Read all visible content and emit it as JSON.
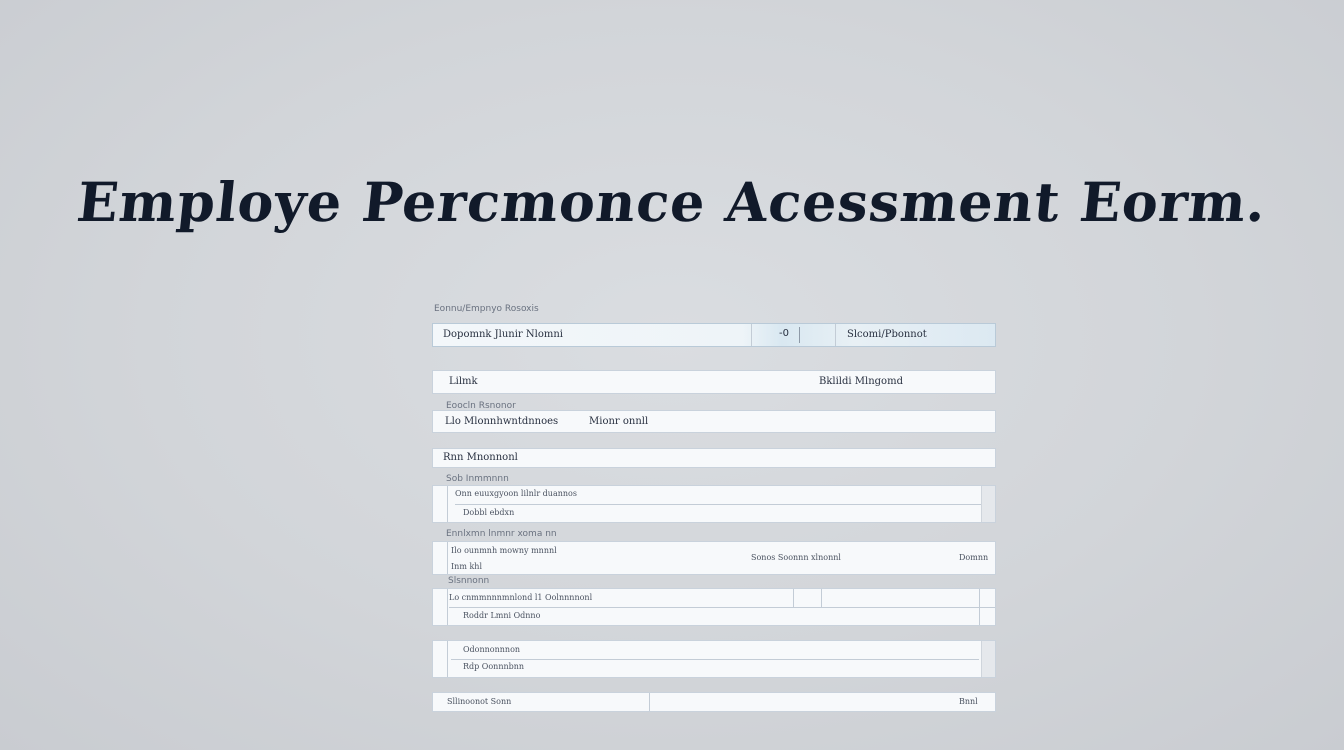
{
  "page_title": "Employe Percmonce Acessment Eorm.",
  "form": {
    "section_label": "Eonnu/Empnyo Rosoxis",
    "row1": {
      "field_value": "Dopomnk Jlunir Nlomni",
      "icon_text": "-0",
      "right_value": "Slcomi/Pbonnot"
    },
    "row2": {
      "left_value": "Lilmk",
      "right_value": "Bklildi Mlngomd"
    },
    "row3": {
      "label": "Eoocln Rsnonor",
      "left_value": "Llo Mlonnhwntdnnoes",
      "right_value": "Mionr onnll"
    },
    "row4": {
      "value": "Rnn Mnonnonl"
    },
    "row5": {
      "label": "Sob Inmmnnn",
      "line1": "Onn euuxgyoon lilnlr duannos",
      "line2": "Dobbl ebdxn"
    },
    "row6": {
      "label": "Ennlxmn lnmnr xoma nn",
      "line1": "Ilo ounmnh mowny mnnnl",
      "line2": "Inm khl",
      "mid_value": "Sonos Soonnn xlnonnl",
      "right_value": "Domnn"
    },
    "row7": {
      "label": "Slsnnonn",
      "line1": "Lo cnmmnnnmnlond l1 Oolnnnnonl",
      "line2": "Roddr Lmni Odnno"
    },
    "row8": {
      "line1": "Odonnonnnon",
      "line2": "Rdp Oonnnbnn"
    },
    "row9": {
      "left_value": "Sllinoonot Sonn",
      "right_value": "Bnnl"
    }
  }
}
